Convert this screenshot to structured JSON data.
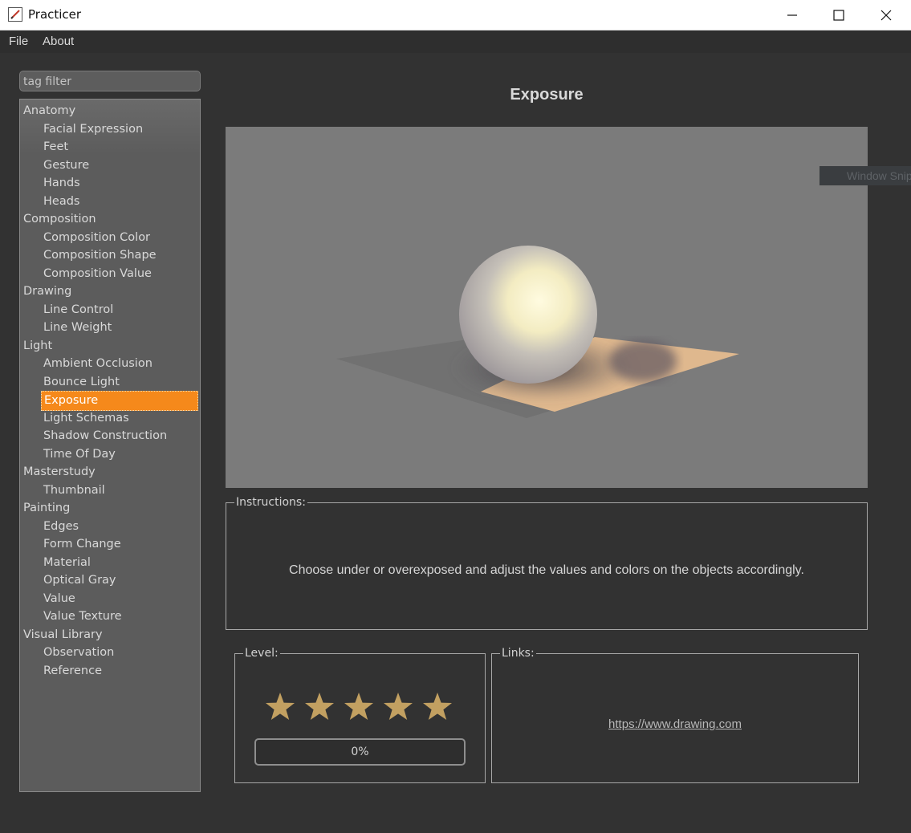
{
  "window": {
    "title": "Practicer",
    "controls": [
      "minimize-icon",
      "maximize-icon",
      "close-icon"
    ]
  },
  "menu": {
    "items": [
      "File",
      "About"
    ]
  },
  "sidebar": {
    "filter_placeholder": "tag filter",
    "tree": [
      {
        "label": "Anatomy",
        "level": 0
      },
      {
        "label": "Facial Expression",
        "level": 1
      },
      {
        "label": "Feet",
        "level": 1
      },
      {
        "label": "Gesture",
        "level": 1
      },
      {
        "label": "Hands",
        "level": 1
      },
      {
        "label": "Heads",
        "level": 1
      },
      {
        "label": "Composition",
        "level": 0
      },
      {
        "label": "Composition Color",
        "level": 1
      },
      {
        "label": "Composition Shape",
        "level": 1
      },
      {
        "label": "Composition Value",
        "level": 1
      },
      {
        "label": "Drawing",
        "level": 0
      },
      {
        "label": "Line Control",
        "level": 1
      },
      {
        "label": "Line Weight",
        "level": 1
      },
      {
        "label": "Light",
        "level": 0
      },
      {
        "label": "Ambient Occlusion",
        "level": 1
      },
      {
        "label": "Bounce Light",
        "level": 1
      },
      {
        "label": "Exposure",
        "level": 1,
        "selected": true
      },
      {
        "label": "Light Schemas",
        "level": 1
      },
      {
        "label": "Shadow Construction",
        "level": 1
      },
      {
        "label": "Time Of Day",
        "level": 1
      },
      {
        "label": "Masterstudy",
        "level": 0
      },
      {
        "label": "Thumbnail",
        "level": 1
      },
      {
        "label": "Painting",
        "level": 0
      },
      {
        "label": "Edges",
        "level": 1
      },
      {
        "label": "Form Change",
        "level": 1
      },
      {
        "label": "Material",
        "level": 1
      },
      {
        "label": "Optical Gray",
        "level": 1
      },
      {
        "label": "Value",
        "level": 1
      },
      {
        "label": "Value Texture",
        "level": 1
      },
      {
        "label": "Visual Library",
        "level": 0
      },
      {
        "label": "Observation",
        "level": 1
      },
      {
        "label": "Reference",
        "level": 1
      }
    ]
  },
  "main": {
    "title": "Exposure",
    "instructions_label": "Instructions:",
    "instructions_text": "Choose under or overexposed and adjust the values and colors on the objects accordingly.",
    "level_label": "Level:",
    "stars_total": 5,
    "progress_text": "0%",
    "progress_value": 0,
    "links_label": "Links:",
    "link_url": "https://www.drawing.com"
  },
  "overlay": {
    "snip_text": "Window Snip"
  },
  "colors": {
    "background": "#323232",
    "selection": "#f5891b",
    "star": "#c2a061",
    "preview_bg": "#7b7b7b"
  }
}
